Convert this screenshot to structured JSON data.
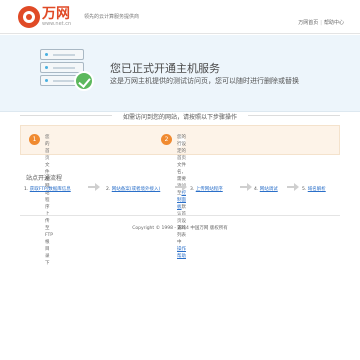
{
  "header": {
    "logo_text": "万网",
    "logo_url": "www.net.cn",
    "tagline": "领先的云计算服务提供商",
    "links": [
      "万网首页",
      "帮助中心"
    ]
  },
  "hero": {
    "title": "您已正式开通主机服务",
    "subtitle": "这是万网主机提供的测试访问页，您可以随时进行删除或替换"
  },
  "instructions": {
    "title": "如需访问到您的网站，请按照以下步骤操作",
    "steps": [
      {
        "num": "1",
        "line1": "您的首页文件及网站程序上传至FTP",
        "line2": "根目录下"
      },
      {
        "num": "2",
        "line1_pre": "您的行设定的首页文件名，需要添加至",
        "line1_link": "控制面板",
        "line1_post": "默认首页设置的列表中",
        "line2_link": "操作帮助"
      }
    ]
  },
  "flow": {
    "title": "站点开通流程",
    "items": [
      {
        "num": "1.",
        "label": "获取FTP/数据库信息"
      },
      {
        "num": "2.",
        "label": "网站备案(或者境外接入)"
      },
      {
        "num": "3.",
        "label": "上传网站程序"
      },
      {
        "num": "4.",
        "label": "网站调试"
      },
      {
        "num": "5.",
        "label": "域名解析"
      }
    ]
  },
  "footer": {
    "text": "Copyright © 1998 - 2014 中国万网 版权所有"
  },
  "colors": {
    "brand": "#e04a26",
    "accent": "#f08a30",
    "link": "#2a6fc9",
    "hero_bg": "#edf5fb",
    "steps_bg": "#fdf3e8",
    "check": "#5cb85c"
  }
}
